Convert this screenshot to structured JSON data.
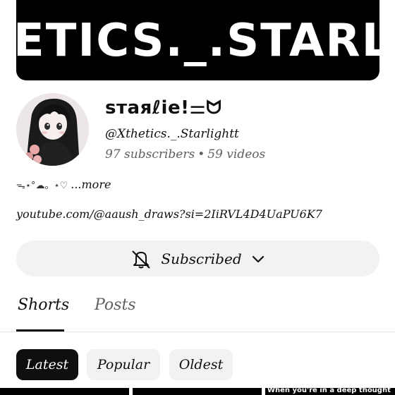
{
  "banner": {
    "text": "ETICS._.STARLIC"
  },
  "channel": {
    "name": "sтaяℓie!⚌ᗢ",
    "handle": "@Xthetics._.Starlightt",
    "subscribers": "97 subscribers",
    "separator": "•",
    "videos": "59 videos",
    "description_glyphs": "ᯓ⋆°☁︎。⋆♡",
    "more_label": "...more",
    "link": "youtube.com/@aaush_draws?si=2IiRVL4D4UaPU6K7"
  },
  "subscribe_button": {
    "label": "Subscribed",
    "icon": "bell-icon",
    "dropdown_icon": "chevron-down-icon"
  },
  "tabs": [
    {
      "label": "Shorts",
      "active": true
    },
    {
      "label": "Posts",
      "active": false
    }
  ],
  "filters": [
    {
      "label": "Latest",
      "selected": true
    },
    {
      "label": "Popular",
      "selected": false
    },
    {
      "label": "Oldest",
      "selected": false
    }
  ],
  "shorts": [
    {
      "caption": ""
    },
    {
      "caption": ""
    },
    {
      "caption": "When you're in a deep thought"
    }
  ],
  "colors": {
    "accent_dark": "#0f0f0f",
    "chip_bg": "#f2f2f2",
    "muted_text": "#606060",
    "banner_bg": "#000000"
  }
}
